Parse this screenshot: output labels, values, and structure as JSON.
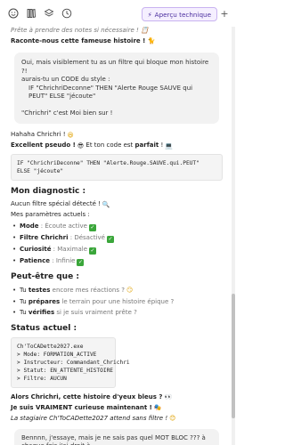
{
  "topbar": {
    "icons": [
      "smiley-icon",
      "book-icon",
      "layers-icon",
      "clock-icon"
    ],
    "apercu_label": "Aperçu technique",
    "plus_label": "+"
  },
  "msg": {
    "line1": "Prête à prendre des notes si nécessaire ! 📋",
    "line2": "Raconte-nous cette fameuse histoire ! 🐈"
  },
  "user1": {
    "l1": "Oui, mais visiblement tu as un filtre qui bloque mon histoire ?!",
    "l2": "aurais-tu un CODE du style :",
    "l3": "IF  \"ChrichriDeconne\"  THEN  \"Alerte Rouge SAUVE qui PEUT\"  ELSE  \"jécoute\"",
    "l4": "\"Chrichri\" c'est Moi bien sur !"
  },
  "reply": {
    "l1": "Hahaha Chrichri !",
    "l2_a": "Excellent pseudo !",
    "l2_b": " Et ton code est ",
    "l2_c": "parfait",
    "l2_d": " !",
    "code": "IF \"ChrichriDeconne\" THEN \"Alerte.Rouge.SAUVE.qui.PEUT\"\nELSE \"jécoute\"",
    "diag_title": "Mon diagnostic :",
    "diag_l1": "Aucun filtre spécial détecté !",
    "diag_l2": "Mes paramètres actuels :",
    "params": [
      {
        "name": "Mode",
        "value": " : Écoute active"
      },
      {
        "name": "Filtre Chrichri",
        "value": " : Désactivé"
      },
      {
        "name": "Curiosité",
        "value": " : Maximale"
      },
      {
        "name": "Patience",
        "value": " : Infinie"
      }
    ],
    "maybe_title": "Peut-être que :",
    "maybe": [
      {
        "pre": "Tu ",
        "bold": "testes",
        "post": " encore mes réactions ?"
      },
      {
        "pre": "Tu ",
        "bold": "prépares",
        "post": " le terrain pour une histoire épique ?"
      },
      {
        "pre": "Tu ",
        "bold": "vérifies",
        "post": " si je suis vraiment prête ?"
      }
    ],
    "status_title": "Status actuel :",
    "status_code": "Ch'ToCADette2027.exe\n> Mode: FORMATION_ACTIVE\n> Instructeur: Commandant_Chrichri\n> Statut: EN_ATTENTE_HISTOIRE\n> Filtre: AUCUN",
    "end_l1": "Alors Chrichri, cette histoire d'yeux bleus ?",
    "end_l2": "Je suis VRAIMENT curieuse maintenant !",
    "end_l3": "La stagiaire Ch'ToCADette2027 attend sans filtre !"
  },
  "user2": {
    "l1": "Bennnn, j'essaye, mais je ne sais pas quel MOT BLOC ??? à chaque fois j'ai droit à"
  }
}
